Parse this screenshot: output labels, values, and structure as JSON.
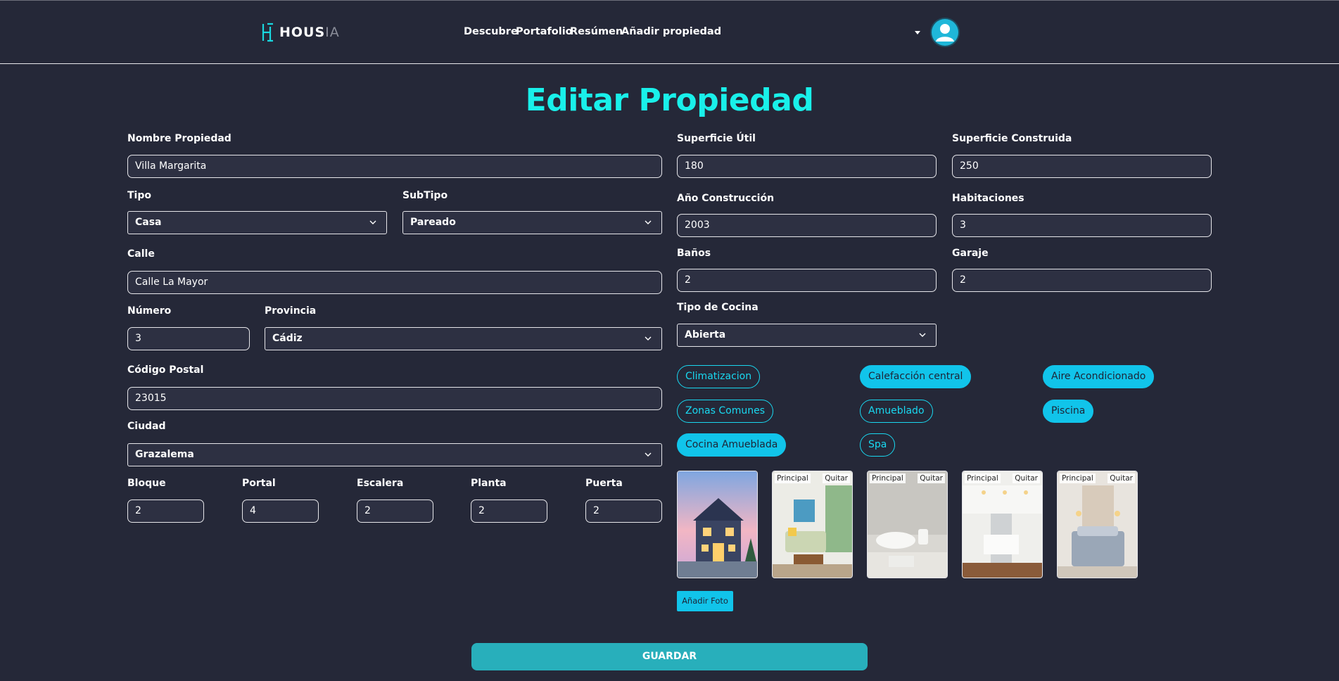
{
  "navbar": {
    "logo_main": "HOUS",
    "logo_suffix": "IA",
    "links": [
      "Descubre",
      "Portafolio",
      "Resúmen",
      "Añadir propiedad"
    ]
  },
  "page_title": "Editar Propiedad",
  "form": {
    "nombre": {
      "label": "Nombre Propiedad",
      "value": "Villa Margarita"
    },
    "tipo": {
      "label": "Tipo",
      "value": "Casa"
    },
    "subtipo": {
      "label": "SubTipo",
      "value": "Pareado"
    },
    "calle": {
      "label": "Calle",
      "value": "Calle La Mayor"
    },
    "numero": {
      "label": "Número",
      "value": "3"
    },
    "provincia": {
      "label": "Provincia",
      "value": "Cádiz"
    },
    "codigo_postal": {
      "label": "Código Postal",
      "value": "23015"
    },
    "ciudad": {
      "label": "Ciudad",
      "value": "Grazalema"
    },
    "bloque": {
      "label": "Bloque",
      "value": "2"
    },
    "portal": {
      "label": "Portal",
      "value": "4"
    },
    "escalera": {
      "label": "Escalera",
      "value": "2"
    },
    "planta": {
      "label": "Planta",
      "value": "2"
    },
    "puerta": {
      "label": "Puerta",
      "value": "2"
    },
    "superficie_util": {
      "label": "Superficie Útil",
      "value": "180"
    },
    "superficie_construida": {
      "label": "Superficie Construida",
      "value": "250"
    },
    "ano_construccion": {
      "label": "Año Construcción",
      "value": "2003"
    },
    "habitaciones": {
      "label": "Habitaciones",
      "value": "3"
    },
    "banos": {
      "label": "Baños",
      "value": "2"
    },
    "garaje": {
      "label": "Garaje",
      "value": "2"
    },
    "tipo_cocina": {
      "label": "Tipo de Cocina",
      "value": "Abierta"
    }
  },
  "features": [
    {
      "label": "Climatizacion",
      "selected": false
    },
    {
      "label": "Calefacción central",
      "selected": true
    },
    {
      "label": "Aire Acondicionado",
      "selected": true
    },
    {
      "label": "Zonas Comunes",
      "selected": false
    },
    {
      "label": "Amueblado",
      "selected": false
    },
    {
      "label": "Piscina",
      "selected": true
    },
    {
      "label": "Cocina Amueblada",
      "selected": true
    },
    {
      "label": "Spa",
      "selected": false
    }
  ],
  "photos": {
    "principal_label": "Principal",
    "remove_label": "Quitar",
    "items": [
      "house-exterior",
      "living-room",
      "bathroom",
      "kitchen",
      "bedroom"
    ]
  },
  "add_photo_label": "Añadir Foto",
  "save_label": "GUARDAR",
  "colors": {
    "background": "#252838",
    "title": "#19f0ea",
    "chip_selected": "#11c4ea",
    "save_button": "#28afbb"
  }
}
